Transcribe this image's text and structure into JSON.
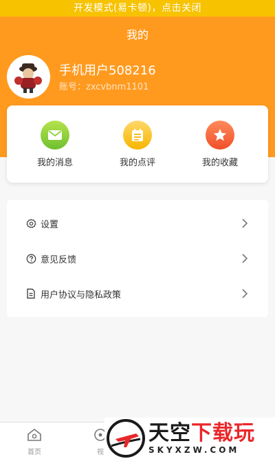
{
  "dev_banner": "开发模式(易卡顿)，点击关闭",
  "header": {
    "title": "我的"
  },
  "user": {
    "name": "手机用户508216",
    "account": "账号：zxcvbnm1101"
  },
  "quick_actions": [
    {
      "label": "我的消息",
      "icon": "message-icon",
      "color": "#8ccf3a"
    },
    {
      "label": "我的点评",
      "icon": "review-icon",
      "color": "#f7c02a"
    },
    {
      "label": "我的收藏",
      "icon": "star-icon",
      "color": "#f5653a"
    }
  ],
  "settings": [
    {
      "label": "设置",
      "icon": "gear-icon"
    },
    {
      "label": "意见反馈",
      "icon": "help-icon"
    },
    {
      "label": "用户协议与隐私政策",
      "icon": "document-icon"
    }
  ],
  "tabbar": {
    "home": {
      "label": "首页",
      "icon": "home-icon"
    },
    "video": {
      "label": "视",
      "icon": "video-icon"
    }
  },
  "watermark": {
    "brand_main": "天空",
    "brand_accent": "下载玩",
    "domain": "SKYXZW.COM"
  },
  "colors": {
    "accent": "#ff9a1f",
    "banner": "#f7c200",
    "background": "#f7f7f7"
  }
}
